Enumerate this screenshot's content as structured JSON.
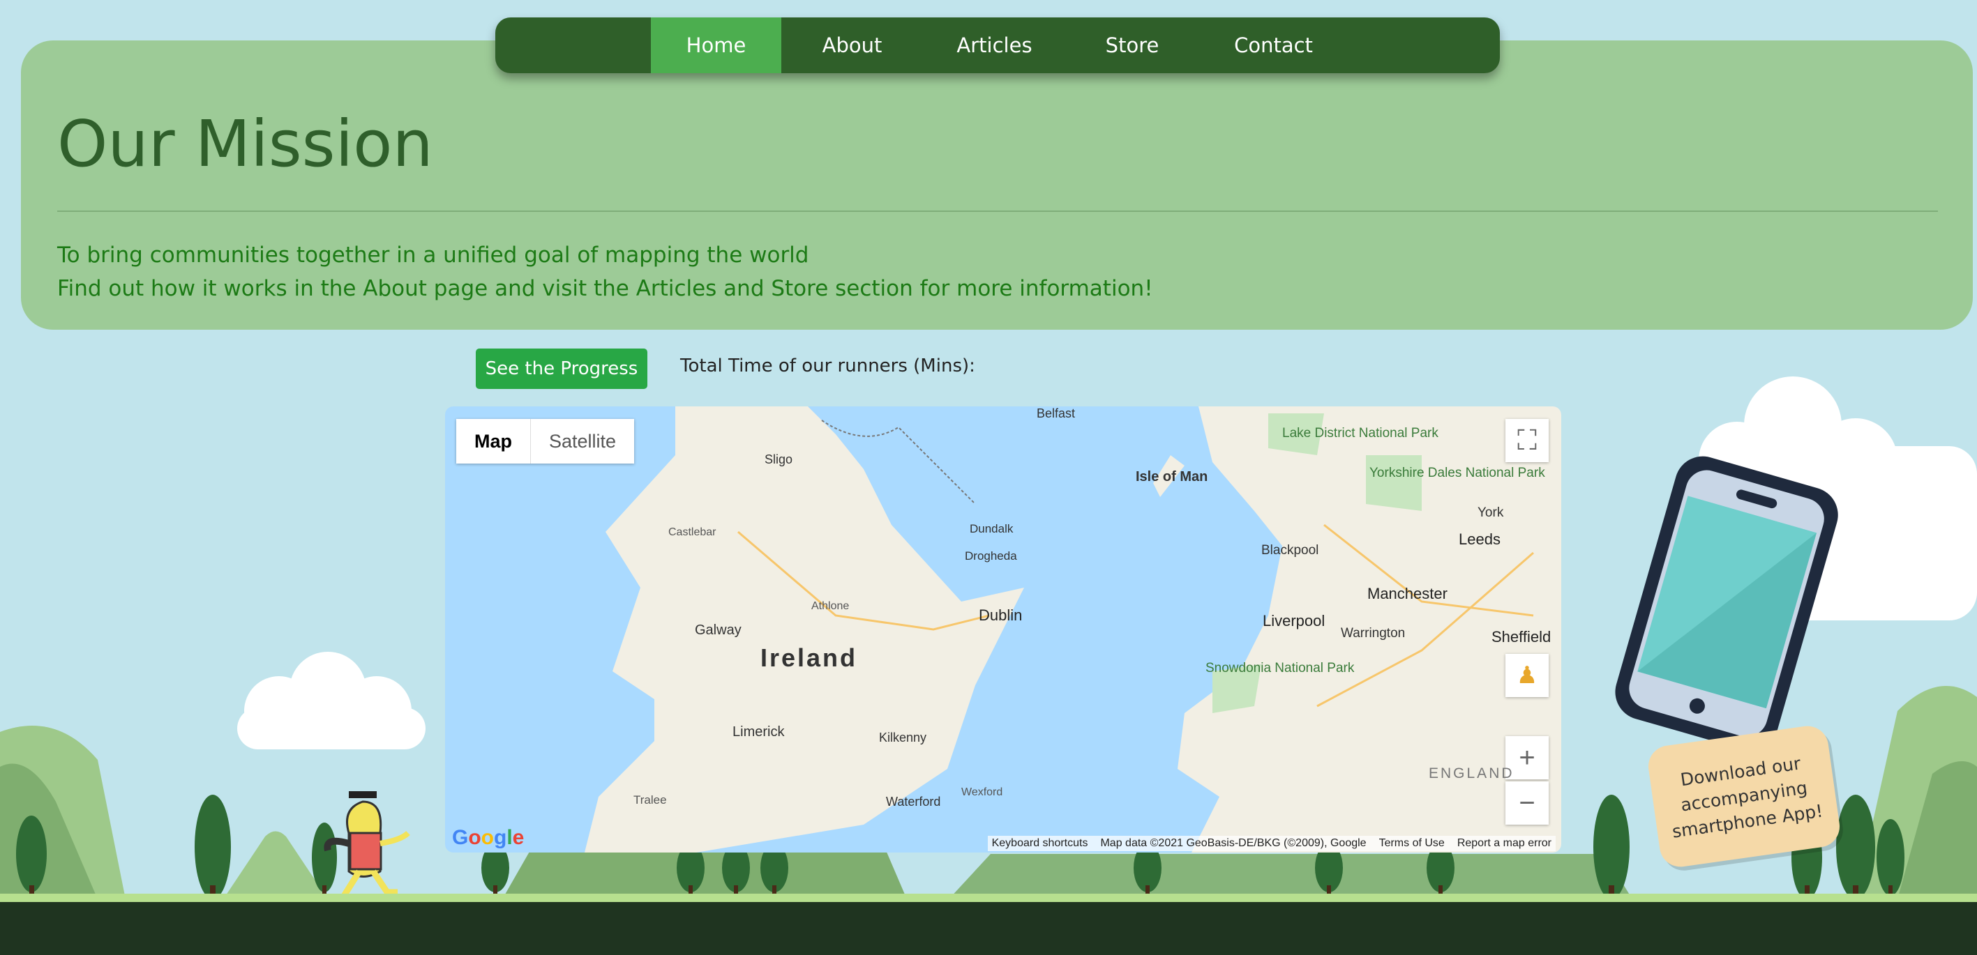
{
  "nav": {
    "items": [
      "Home",
      "About",
      "Articles",
      "Store",
      "Contact"
    ],
    "active": "Home"
  },
  "mission": {
    "title": "Our Mission",
    "line1": "To bring communities together in a unified goal of mapping the world",
    "line2": "Find out how it works in the About page and visit the Articles and Store section for more information!"
  },
  "progress": {
    "button_label": "See the Progress",
    "total_label": "Total Time of our runners (Mins):"
  },
  "map": {
    "type_options": [
      "Map",
      "Satellite"
    ],
    "selected_type": "Map",
    "labels": {
      "ireland": "Ireland",
      "isle_of_man": "Isle of Man",
      "dublin": "Dublin",
      "galway": "Galway",
      "limerick": "Limerick",
      "belfast": "Belfast",
      "liverpool": "Liverpool",
      "manchester": "Manchester",
      "leeds": "Leeds",
      "sheffield": "Sheffield",
      "snowdonia": "Snowdonia National Park",
      "lake_district": "Lake District National Park",
      "yorkshire": "Yorkshire Dales National Park",
      "waterford": "Waterford",
      "kilkenny": "Kilkenny",
      "sligo": "Sligo",
      "drogheda": "Drogheda",
      "dundalk": "Dundalk",
      "blackpool": "Blackpool",
      "warrington": "Warrington",
      "york": "York",
      "england": "ENGLAND",
      "athlone": "Athlone",
      "castlebar": "Castlebar",
      "tralee": "Tralee",
      "wexford": "Wexford"
    },
    "footer": {
      "shortcuts": "Keyboard shortcuts",
      "data": "Map data ©2021 GeoBasis-DE/BKG (©2009), Google",
      "terms": "Terms of Use",
      "report": "Report a map error"
    },
    "logo": "Google",
    "colors": {
      "water": "#aadaff",
      "land": "#f2efe4",
      "park": "#c8e6c0"
    }
  },
  "promo": {
    "text": "Download our accompanying smartphone App!"
  },
  "colors": {
    "background": "#c1e4ec",
    "nav": "#2f5f29",
    "nav_active": "#4cae4f",
    "mission_card": "#9dcb97",
    "mission_text": "#1c7a15",
    "button": "#28a745"
  }
}
